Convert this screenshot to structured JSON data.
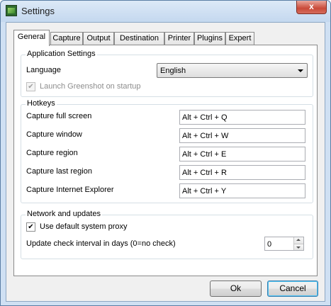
{
  "window": {
    "title": "Settings",
    "close_glyph": "x"
  },
  "tabs": [
    {
      "label": "General"
    },
    {
      "label": "Capture"
    },
    {
      "label": "Output"
    },
    {
      "label": "Destination"
    },
    {
      "label": "Printer"
    },
    {
      "label": "Plugins"
    },
    {
      "label": "Expert"
    }
  ],
  "app_settings": {
    "legend": "Application Settings",
    "language_label": "Language",
    "language_value": "English",
    "launch_label": "Launch Greenshot on startup",
    "launch_checked": true
  },
  "hotkeys": {
    "legend": "Hotkeys",
    "items": [
      {
        "label": "Capture full screen",
        "value": "Alt + Ctrl + Q"
      },
      {
        "label": "Capture window",
        "value": "Alt + Ctrl + W"
      },
      {
        "label": "Capture region",
        "value": "Alt + Ctrl + E"
      },
      {
        "label": "Capture last region",
        "value": "Alt + Ctrl + R"
      },
      {
        "label": "Capture Internet Explorer",
        "value": "Alt + Ctrl + Y"
      }
    ]
  },
  "network": {
    "legend": "Network and updates",
    "proxy_label": "Use default system proxy",
    "proxy_checked": true,
    "interval_label": "Update check interval in days (0=no check)",
    "interval_value": "0"
  },
  "buttons": {
    "ok": "Ok",
    "cancel": "Cancel"
  },
  "check_glyph": "✔"
}
